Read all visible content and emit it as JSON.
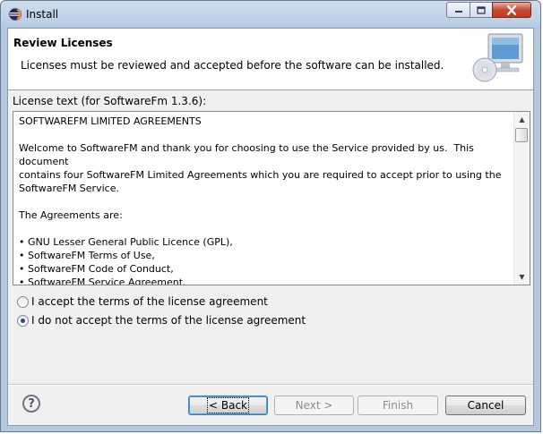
{
  "window": {
    "title": "Install",
    "app_icon": "eclipse-icon",
    "controls": {
      "minimize": "minimize-icon",
      "maximize": "maximize-icon",
      "close": "close-icon"
    }
  },
  "banner": {
    "title": "Review Licenses",
    "description": "Licenses must be reviewed and accepted before the software can be installed.",
    "image": "computer-cd-icon"
  },
  "license": {
    "label": "License text (for SoftwareFm 1.3.6):",
    "lines": [
      "SOFTWAREFM LIMITED AGREEMENTS",
      "",
      "Welcome to SoftwareFM and thank you for choosing to use the Service provided by us.  This document",
      "contains four SoftwareFM Limited Agreements which you are required to accept prior to using the",
      "SoftwareFM Service.",
      "",
      "The Agreements are:",
      "",
      "• GNU Lesser General Public Licence (GPL),",
      "• SoftwareFM Terms of Use,",
      "• SoftwareFM Code of Conduct,",
      "• SoftwareFM Service Agreement."
    ]
  },
  "options": {
    "accept": {
      "label": "I accept the terms of the license agreement",
      "selected": false
    },
    "decline": {
      "label": "I do not accept the terms of the license agreement",
      "selected": true
    }
  },
  "buttons": {
    "help_icon": "help-icon",
    "back": "< Back",
    "next": "Next >",
    "finish": "Finish",
    "cancel": "Cancel"
  }
}
